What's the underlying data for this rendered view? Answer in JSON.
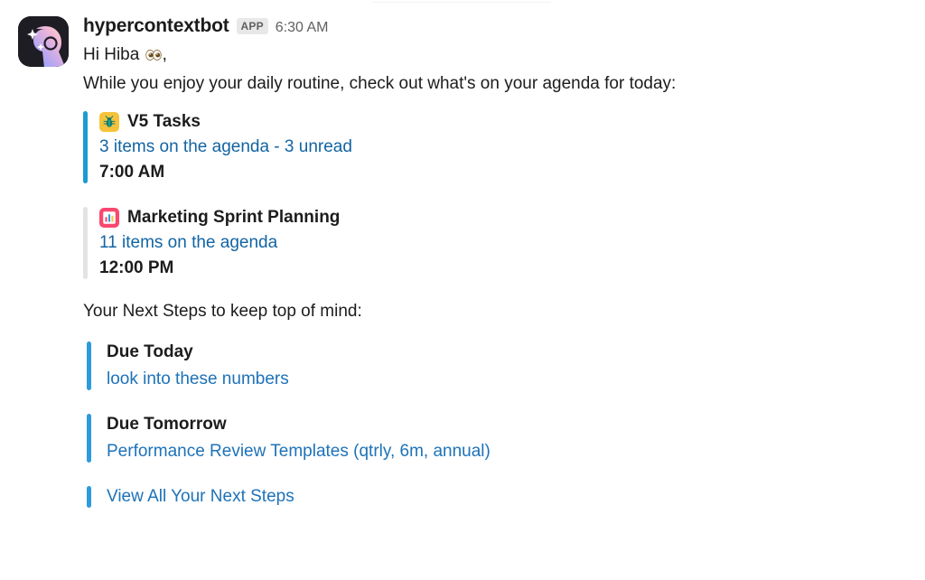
{
  "message": {
    "avatar_icon": "hypercontext-bot-avatar",
    "sender": "hypercontextbot",
    "app_badge": "APP",
    "timestamp": "6:30 AM",
    "greeting": "Hi Hiba ",
    "greeting_emoji": "eyes-emoji",
    "greeting_suffix": ",",
    "intro": "While you enjoy your daily routine, check out what's on your agenda for today:",
    "next_steps_intro": "Your Next Steps to keep top of mind:"
  },
  "agenda": [
    {
      "emoji": "bug-emoji",
      "title": "V5 Tasks",
      "link": "3 items on the agenda - 3 unread",
      "time": "7:00 AM",
      "bar_color": "#1d9bd1"
    },
    {
      "emoji": "bar-chart-emoji",
      "title": "Marketing Sprint Planning",
      "link": "11 items on the agenda",
      "time": "12:00 PM",
      "bar_color": "#e3e3e3"
    }
  ],
  "next_steps": [
    {
      "title": "Due Today",
      "link": "look into these numbers",
      "bar_color": "#2f9ade"
    },
    {
      "title": "Due Tomorrow",
      "link": "Performance Review Templates (qtrly, 6m, annual)",
      "bar_color": "#2f9ade"
    },
    {
      "title": "",
      "link": "View All Your Next Steps",
      "bar_color": "#2f9ade"
    }
  ],
  "colors": {
    "link": "#1264a3",
    "link_alt": "#1d72b8",
    "accent_blue": "#1d9bd1",
    "muted_bar": "#e3e3e3",
    "text": "#1d1c1d",
    "meta_text": "#616061",
    "badge_bg": "#e8e8e8"
  }
}
